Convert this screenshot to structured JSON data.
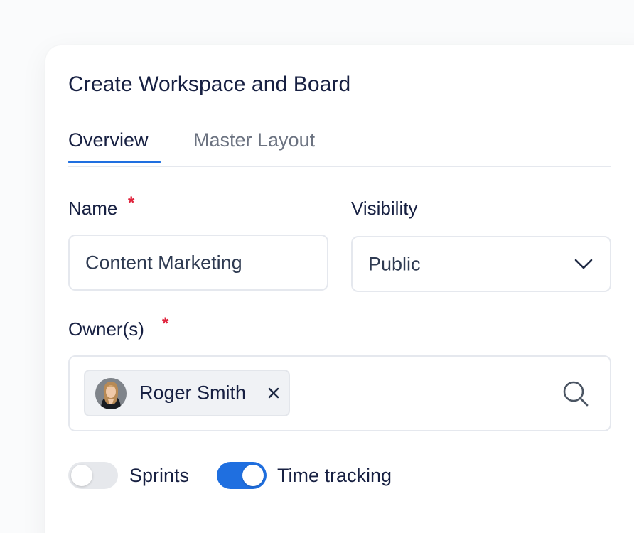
{
  "dialog": {
    "title": "Create Workspace and Board"
  },
  "tabs": [
    {
      "label": "Overview",
      "active": true
    },
    {
      "label": "Master Layout",
      "active": false
    }
  ],
  "form": {
    "name": {
      "label": "Name",
      "required_mark": "*",
      "value": "Content Marketing"
    },
    "visibility": {
      "label": "Visibility",
      "selected": "Public",
      "icon": "chevron-down-icon"
    },
    "owners": {
      "label": "Owner(s)",
      "required_mark": "*",
      "chips": [
        {
          "name": "Roger Smith",
          "close_glyph": "×"
        }
      ],
      "icon": "search-icon"
    },
    "toggles": [
      {
        "label": "Sprints",
        "on": false
      },
      {
        "label": "Time tracking",
        "on": true
      }
    ]
  },
  "colors": {
    "accent": "#1f6fe0",
    "required": "#e0243d",
    "text": "#172042",
    "muted": "#6b7280",
    "border": "#e5e8ee"
  }
}
